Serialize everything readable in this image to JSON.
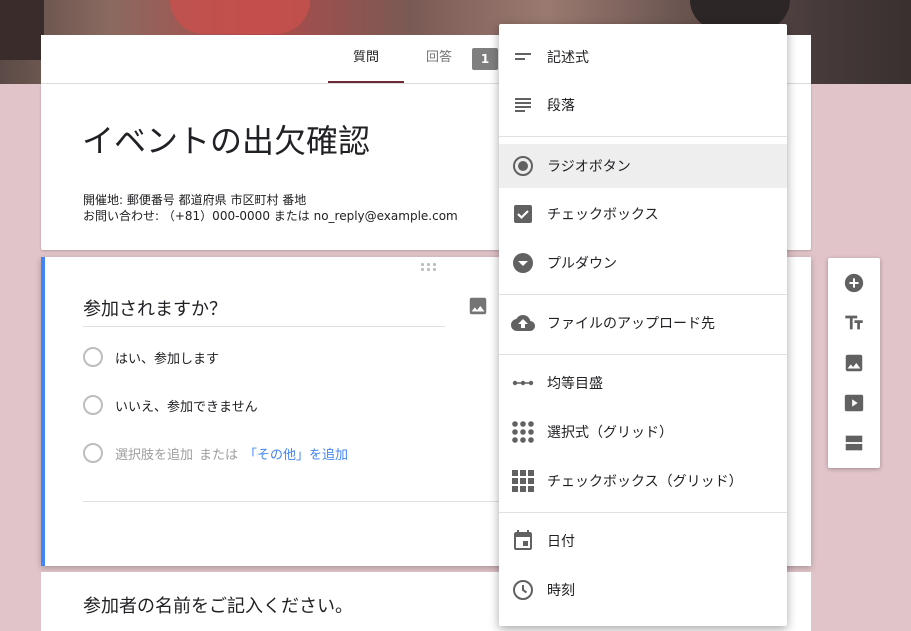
{
  "tabs": {
    "questions": "質問",
    "responses": "回答",
    "response_count": "1"
  },
  "form": {
    "title": "イベントの出欠確認",
    "desc_line1": "開催地: 郵便番号 都道府県 市区町村 番地",
    "desc_line2": "お問い合わせ: （+81）000-0000 または no_reply@example.com"
  },
  "question": {
    "title": "参加されますか？",
    "options": [
      "はい、参加します",
      "いいえ、参加できません"
    ],
    "add_option": "選択肢を追加",
    "or": "または",
    "add_other": "「その他」を追加"
  },
  "question2": {
    "title": "参加者の名前をご記入ください。"
  },
  "menu": {
    "items": [
      {
        "label": "記述式",
        "icon": "short-answer-icon"
      },
      {
        "label": "段落",
        "icon": "paragraph-icon"
      },
      {
        "label": "ラジオボタン",
        "icon": "radio-button-icon",
        "selected": true
      },
      {
        "label": "チェックボックス",
        "icon": "checkbox-icon"
      },
      {
        "label": "プルダウン",
        "icon": "dropdown-icon"
      },
      {
        "label": "ファイルのアップロード先",
        "icon": "cloud-upload-icon"
      },
      {
        "label": "均等目盛",
        "icon": "linear-scale-icon"
      },
      {
        "label": "選択式（グリッド）",
        "icon": "radio-grid-icon"
      },
      {
        "label": "チェックボックス（グリッド）",
        "icon": "checkbox-grid-icon"
      },
      {
        "label": "日付",
        "icon": "calendar-icon"
      },
      {
        "label": "時刻",
        "icon": "clock-icon"
      }
    ]
  },
  "toolbar": [
    "add-question-icon",
    "add-title-icon",
    "add-image-icon",
    "add-video-icon",
    "add-section-icon"
  ],
  "colors": {
    "accent": "#4285f4",
    "tab_underline": "#6d2a36",
    "background": "#e1c4c9",
    "icon": "#616161"
  }
}
